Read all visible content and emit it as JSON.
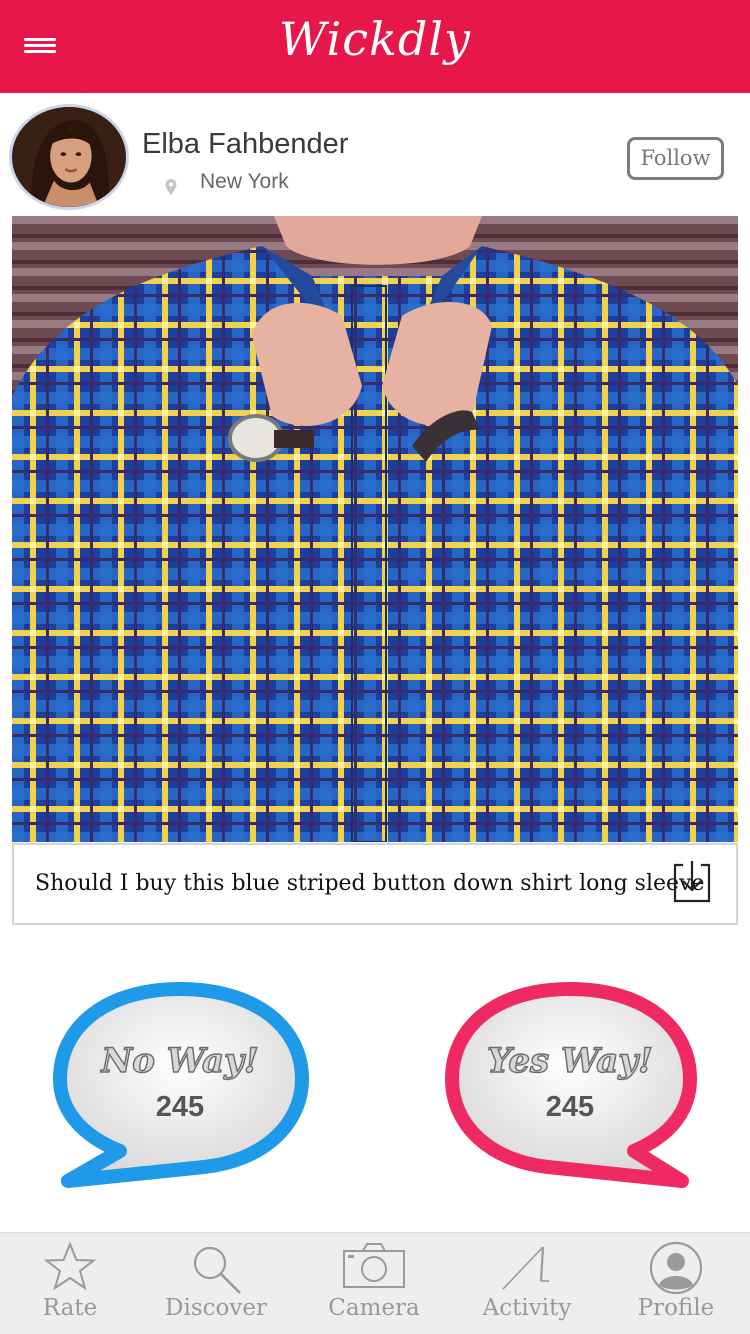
{
  "app": {
    "brand": "Wickdly",
    "accent": "#e8174a"
  },
  "header": {
    "menu_icon": "hamburger-icon"
  },
  "post": {
    "user_name": "Elba Fahbender",
    "location": "New York",
    "follow_label": "Follow",
    "caption": "Should I buy this blue striped button down shirt long sleeve",
    "download_icon": "download-icon"
  },
  "votes": {
    "no": {
      "label": "No Way!",
      "count": "245",
      "color": "#1e9ae8"
    },
    "yes": {
      "label": "Yes Way!",
      "count": "245",
      "color": "#ef2a63"
    }
  },
  "tabs": [
    {
      "label": "Rate",
      "icon": "star-icon"
    },
    {
      "label": "Discover",
      "icon": "search-icon"
    },
    {
      "label": "Camera",
      "icon": "camera-icon"
    },
    {
      "label": "Activity",
      "icon": "activity-icon"
    },
    {
      "label": "Profile",
      "icon": "profile-icon"
    }
  ]
}
